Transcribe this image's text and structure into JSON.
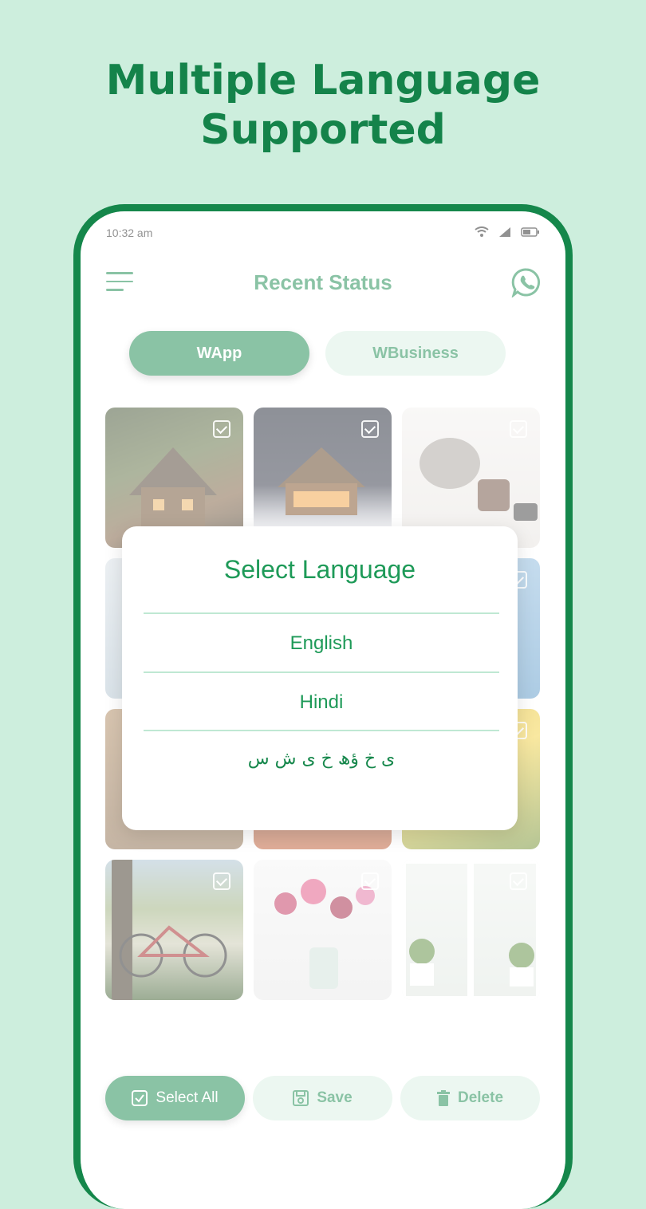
{
  "headline": {
    "line1": "Multiple Language",
    "line2": "Supported"
  },
  "status_bar": {
    "time": "10:32 am"
  },
  "app_bar": {
    "title": "Recent Status"
  },
  "tabs": [
    {
      "label": "WApp"
    },
    {
      "label": "WBusiness"
    }
  ],
  "grid": {
    "tiles": [
      "cabin-forest",
      "cabin-night-snow",
      "tea-pot",
      "glass-vase",
      "sky-plant",
      "wood-texture",
      "fire-glow",
      "yellow-tulips",
      "bicycle-tree",
      "flower-vase",
      "window-plants"
    ]
  },
  "bottom_bar": {
    "select_all": "Select All",
    "save": "Save",
    "delete": "Delete"
  },
  "dialog": {
    "title": "Select Language",
    "options": [
      "English",
      "Hindi",
      "ی خ ؤھ خ ی ش س"
    ]
  },
  "colors": {
    "brand_green": "#15874b",
    "light_green": "#cdeedd",
    "dialog_green": "#1e9a58"
  }
}
